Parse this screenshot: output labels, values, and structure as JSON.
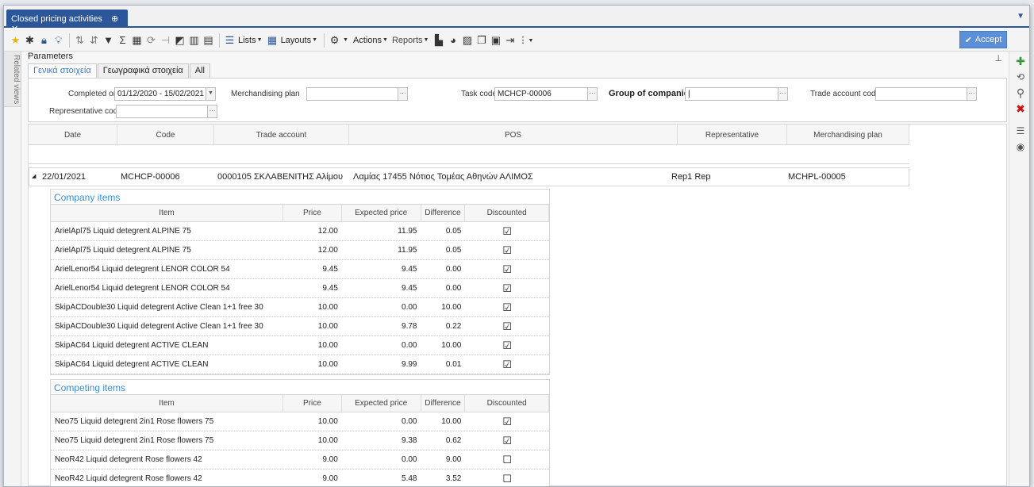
{
  "tab": {
    "title": "Closed pricing activities",
    "actions": "⊕ ✕"
  },
  "toolbar": {
    "lists_label": "Lists",
    "layouts_label": "Layouts",
    "actions_label": "Actions",
    "reports_label": "Reports",
    "more_label": "⋮",
    "accept_label": "Accept"
  },
  "related_views_label": "Related views",
  "parameters": {
    "title": "Parameters",
    "tabs": [
      "Γενικά στοιχεία",
      "Γεωγραφικά στοιχεία",
      "All"
    ],
    "completed_on_label": "Completed on",
    "completed_on_value": "01/12/2020 - 15/02/2021",
    "merch_plan_label": "Merchandising plan",
    "merch_plan_value": "",
    "task_code_label": "Task code",
    "task_code_value": "MCHCP-00006",
    "group_label": "Group of companies",
    "group_value": "|",
    "trade_account_label": "Trade account code",
    "trade_account_value": "",
    "rep_code_label": "Representative code",
    "rep_code_value": ""
  },
  "grid": {
    "headers": [
      "Date",
      "Code",
      "Trade account",
      "POS",
      "Representative",
      "Merchandising plan"
    ],
    "row": {
      "expand": "◢",
      "date": "22/01/2021",
      "code": "MCHCP-00006",
      "trade_account": "0000105 ΣΚΛΑΒΕΝΙΤΗΣ Αλίμου",
      "pos": "Λαμίας 17455 Νότιος Τομέας Αθηνών ΑΛΙΜΟΣ",
      "representative": "Rep1 Rep",
      "merch_plan": "MCHPL-00005"
    }
  },
  "detail_headers": [
    "Item",
    "Price",
    "Expected price",
    "Difference",
    "Discounted"
  ],
  "company_items": {
    "title": "Company items",
    "rows": [
      {
        "item": "ArielApl75 Liquid detegrent ALPINE 75",
        "price": "12.00",
        "expected": "11.95",
        "diff": "0.05",
        "discounted": "☑"
      },
      {
        "item": "ArielApl75 Liquid detegrent ALPINE 75",
        "price": "12.00",
        "expected": "11.95",
        "diff": "0.05",
        "discounted": "☑"
      },
      {
        "item": "ArielLenor54 Liquid detegrent LENOR COLOR 54",
        "price": "9.45",
        "expected": "9.45",
        "diff": "0.00",
        "discounted": "☑"
      },
      {
        "item": "ArielLenor54 Liquid detegrent LENOR COLOR 54",
        "price": "9.45",
        "expected": "9.45",
        "diff": "0.00",
        "discounted": "☑"
      },
      {
        "item": "SkipACDouble30 Liquid detegrent Active Clean 1+1 free 30",
        "price": "10.00",
        "expected": "0.00",
        "diff": "10.00",
        "discounted": "☑"
      },
      {
        "item": "SkipACDouble30 Liquid detegrent Active Clean 1+1 free 30",
        "price": "10.00",
        "expected": "9.78",
        "diff": "0.22",
        "discounted": "☑"
      },
      {
        "item": "SkipAC64 Liquid detegrent ACTIVE CLEAN",
        "price": "10.00",
        "expected": "0.00",
        "diff": "10.00",
        "discounted": "☑"
      },
      {
        "item": "SkipAC64 Liquid detegrent ACTIVE CLEAN",
        "price": "10.00",
        "expected": "9.99",
        "diff": "0.01",
        "discounted": "☑"
      }
    ]
  },
  "competing_items": {
    "title": "Competing items",
    "rows": [
      {
        "item": "Neo75 Liquid detegrent 2in1 Rose flowers 75",
        "price": "10.00",
        "expected": "0.00",
        "diff": "10.00",
        "discounted": "☑"
      },
      {
        "item": "Neo75 Liquid detegrent 2in1 Rose flowers 75",
        "price": "10.00",
        "expected": "9.38",
        "diff": "0.62",
        "discounted": "☑"
      },
      {
        "item": "NeoR42 Liquid detegrent Rose flowers 42",
        "price": "9.00",
        "expected": "0.00",
        "diff": "9.00",
        "discounted": "☐"
      },
      {
        "item": "NeoR42 Liquid detegrent Rose flowers 42",
        "price": "9.00",
        "expected": "5.48",
        "diff": "3.52",
        "discounted": "☐"
      }
    ]
  }
}
